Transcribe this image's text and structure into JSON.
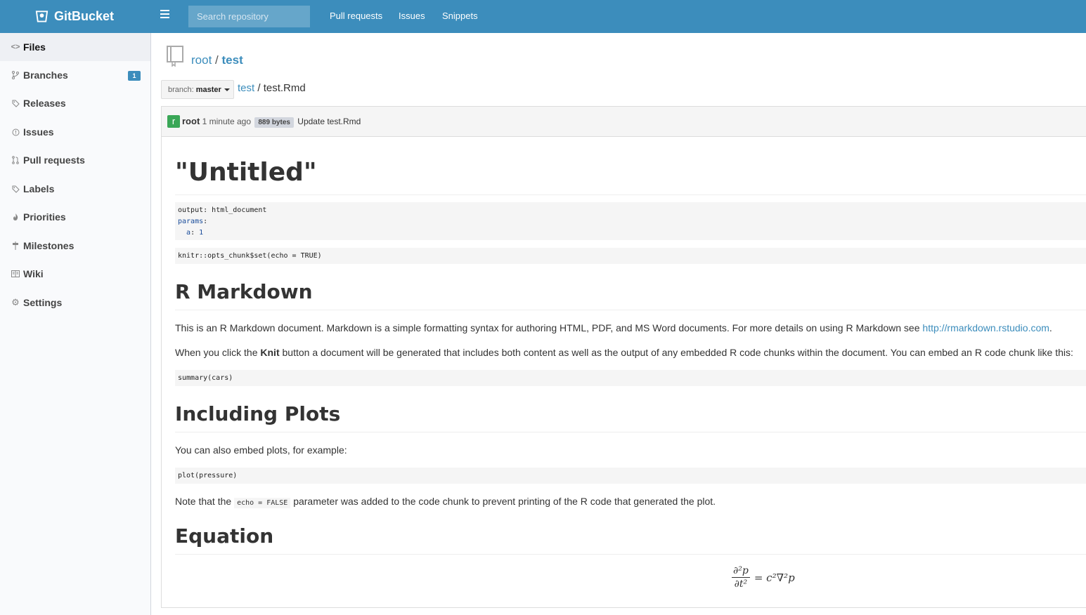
{
  "navbar": {
    "brand": "GitBucket",
    "search_placeholder": "Search repository",
    "links": [
      "Pull requests",
      "Issues",
      "Snippets"
    ]
  },
  "sidebar": {
    "items": [
      {
        "label": "Files",
        "icon": "code-icon"
      },
      {
        "label": "Branches",
        "icon": "branch-icon",
        "badge": "1"
      },
      {
        "label": "Releases",
        "icon": "tag-icon"
      },
      {
        "label": "Issues",
        "icon": "issue-opened-icon"
      },
      {
        "label": "Pull requests",
        "icon": "pull-request-icon"
      },
      {
        "label": "Labels",
        "icon": "tag-icon"
      },
      {
        "label": "Priorities",
        "icon": "flame-icon"
      },
      {
        "label": "Milestones",
        "icon": "milestone-icon"
      },
      {
        "label": "Wiki",
        "icon": "book-icon"
      },
      {
        "label": "Settings",
        "icon": "gear-icon"
      }
    ]
  },
  "repo": {
    "owner": "root",
    "separator": "/",
    "name": "test"
  },
  "branch": {
    "prefix": "branch:",
    "name": "master"
  },
  "path": {
    "root": "test",
    "separator": "/",
    "file": "test.Rmd"
  },
  "commit": {
    "avatar_letter": "r",
    "author": "root",
    "time": "1 minute ago",
    "size": "889 bytes",
    "message": "Update test.Rmd"
  },
  "markdown": {
    "title": "\"Untitled\"",
    "yaml": {
      "line1_key": "output",
      "line1_val": "html_document",
      "line2_key": "params",
      "line3_key": "a",
      "line3_val": "1"
    },
    "setup_code": "knitr::opts_chunk$set(echo = TRUE)",
    "h_rmarkdown": "R Markdown",
    "p1_text": "This is an R Markdown document. Markdown is a simple formatting syntax for authoring HTML, PDF, and MS Word documents. For more details on using R Markdown see ",
    "p1_link": "http://rmarkdown.rstudio.com",
    "p1_end": ".",
    "p2_start": "When you click the ",
    "p2_bold": "Knit",
    "p2_end": " button a document will be generated that includes both content as well as the output of any embedded R code chunks within the document. You can embed an R code chunk like this:",
    "summary_code": "summary(cars)",
    "h_plots": "Including Plots",
    "p3": "You can also embed plots, for example:",
    "plot_code": "plot(pressure)",
    "p4_start": "Note that the ",
    "p4_code": "echo = FALSE",
    "p4_end": " parameter was added to the code chunk to prevent printing of the R code that generated the plot.",
    "h_equation": "Equation",
    "equation": {
      "num": "∂²p",
      "den": "∂t²",
      "rhs": "= c²∇²p"
    }
  },
  "colors": {
    "navbar": "#3c8dbc",
    "link": "#3c8dbc",
    "badge": "#3c8dbc",
    "avatar": "#3aa757"
  }
}
